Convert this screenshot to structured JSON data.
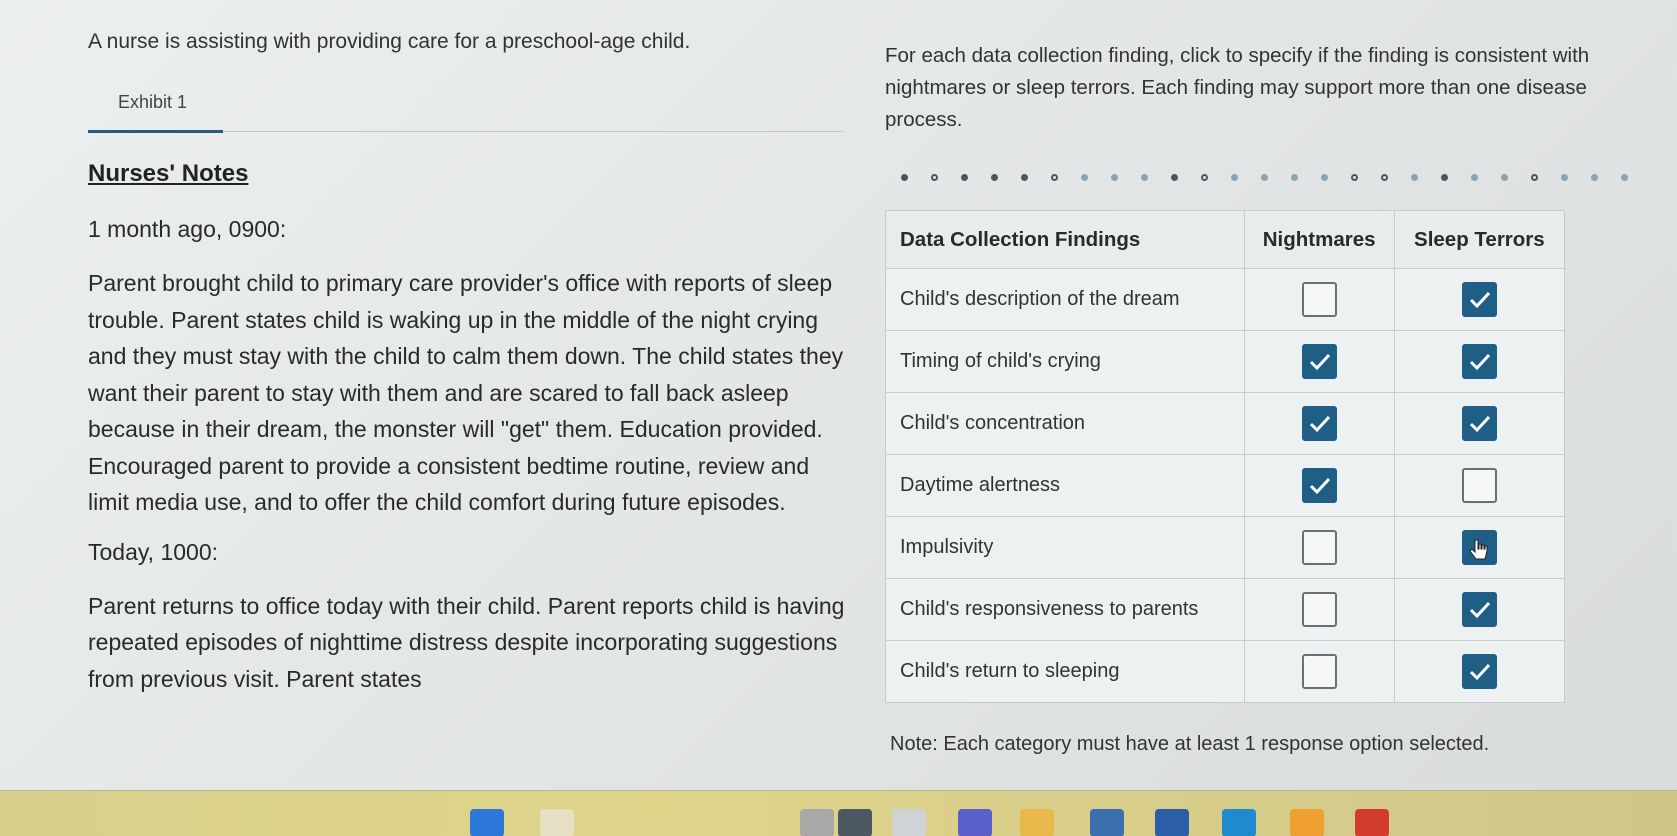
{
  "stem": "A nurse is assisting with providing care for a preschool-age child.",
  "tabs": [
    {
      "label": "Exhibit 1",
      "active": true
    }
  ],
  "notes": {
    "title": "Nurses' Notes",
    "entries": [
      {
        "time": "1 month ago, 0900:",
        "text": "Parent brought child to primary care provider's office with reports of sleep trouble. Parent states child is waking up in the middle of the night crying and they must stay with the child to calm them down. The child states they want their parent to stay with them and are scared to fall back asleep because in their dream, the monster will \"get\" them. Education provided. Encouraged parent to provide a consistent bedtime routine, review and limit media use, and to offer the child comfort during future episodes."
      },
      {
        "time": "Today, 1000:",
        "text": "Parent returns to office today with their child. Parent reports child is having repeated episodes of nighttime distress despite incorporating suggestions from previous visit. Parent states"
      }
    ]
  },
  "instructions": "For each data collection finding, click to specify if the finding is consistent with nightmares or sleep terrors. Each finding may support more than one disease process.",
  "grid": {
    "headers": [
      "Data Collection Findings",
      "Nightmares",
      "Sleep Terrors"
    ],
    "rows": [
      {
        "finding": "Child's description of the dream",
        "nightmares": false,
        "sleep_terrors": true
      },
      {
        "finding": "Timing of child's crying",
        "nightmares": true,
        "sleep_terrors": true
      },
      {
        "finding": "Child's concentration",
        "nightmares": true,
        "sleep_terrors": true
      },
      {
        "finding": "Daytime alertness",
        "nightmares": true,
        "sleep_terrors": false
      },
      {
        "finding": "Impulsivity",
        "nightmares": false,
        "sleep_terrors": true
      },
      {
        "finding": "Child's responsiveness to parents",
        "nightmares": false,
        "sleep_terrors": true
      },
      {
        "finding": "Child's return to sleeping",
        "nightmares": false,
        "sleep_terrors": true
      }
    ]
  },
  "note": "Note: Each category must have at least 1 response option selected.",
  "colors": {
    "checked": "#1f5f86",
    "tab_underline": "#2d5a7a"
  },
  "taskbar_icons": [
    "windows-start-icon",
    "search-icon",
    "widgets-icon",
    "calculator-icon",
    "taskview-icon",
    "chat-icon",
    "file-explorer-icon",
    "store-icon",
    "app-icon",
    "edge-icon",
    "weather-icon",
    "gmail-icon"
  ]
}
